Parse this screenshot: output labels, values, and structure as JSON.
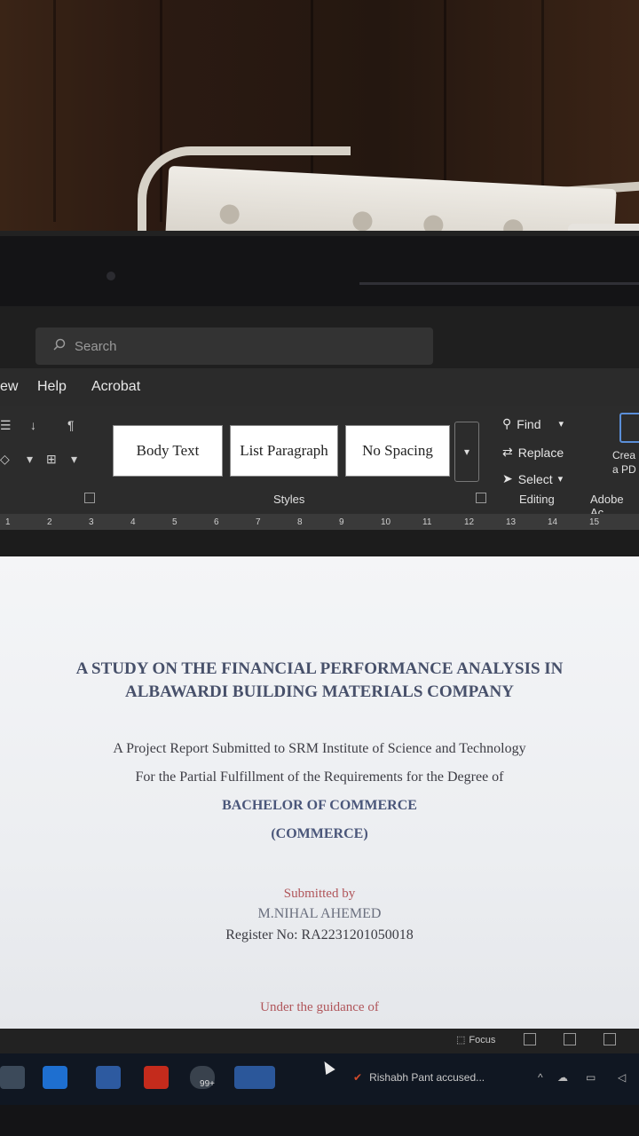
{
  "search": {
    "placeholder": "Search"
  },
  "tabs": [
    {
      "label": "ew"
    },
    {
      "label": "Help"
    },
    {
      "label": "Acrobat"
    }
  ],
  "styles": {
    "items": [
      "Body Text",
      "List Paragraph",
      "No Spacing"
    ],
    "group_label": "Styles"
  },
  "editing": {
    "find": "Find",
    "replace": "Replace",
    "select": "Select",
    "group_label": "Editing"
  },
  "acrobat_group": {
    "button_line1": "Crea",
    "button_line2": "a PD",
    "group_label": "Adobe Ac"
  },
  "ruler": {
    "ticks": [
      "1",
      "2",
      "3",
      "4",
      "5",
      "6",
      "7",
      "8",
      "9",
      "10",
      "11",
      "12",
      "13",
      "14",
      "15"
    ]
  },
  "document": {
    "title_line1": "A STUDY ON THE FINANCIAL PERFORMANCE ANALYSIS IN",
    "title_line2": "ALBAWARDI BUILDING MATERIALS COMPANY",
    "subtitle_line1": "A Project Report Submitted to SRM Institute of Science and Technology",
    "subtitle_line2": "For the Partial Fulfillment of the Requirements for the Degree of",
    "degree": "BACHELOR OF COMMERCE",
    "degree_sub": "(COMMERCE)",
    "submitted_by": "Submitted by",
    "student_name": "M.NIHAL AHEMED",
    "register_no": "Register No: RA2231201050018",
    "guidance": "Under the guidance of"
  },
  "statusbar": {
    "focus": "Focus"
  },
  "taskbar": {
    "news": "Rishabh Pant accused...",
    "badge": "99+"
  },
  "colors": {
    "ribbon_bg": "#2c2c2c",
    "title_text": "#47506a",
    "accent_red": "#b0555a",
    "taskbar_bg": "#101722"
  }
}
